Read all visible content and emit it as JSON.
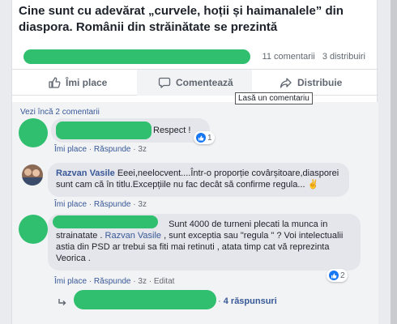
{
  "post": {
    "title": "Cine sunt cu adevărat „curvele, hoții și haimanalele” din diaspora. Românii din străinătate se prezintă"
  },
  "stats": {
    "comments": "11 comentarii",
    "shares": "3 distribuiri"
  },
  "actions": {
    "like": "Îmi place",
    "comment": "Comentează",
    "share": "Distribuie",
    "tooltip": "Lasă un comentariu"
  },
  "comments_section": {
    "previous": "Vezi încă 2 comentarii",
    "comments": [
      {
        "text": "Respect !",
        "like": "Îmi place",
        "reply": "Răspunde",
        "time": "3z",
        "reactions": "1"
      },
      {
        "author": "Razvan Vasile",
        "text": "Eeei,neelocvent....Într-o proporție covârșitoare,diasporei sunt cam că în titlu.Excepțiile nu fac decât să confirme regula...",
        "like": "Îmi place",
        "reply": "Răspunde",
        "time": "3z"
      },
      {
        "text_part1": "Sunt 4000 de turneni plecati la munca in strainatate .",
        "mention": "Razvan Vasile",
        "text_part2": ", sunt exceptia sau \"regula \" ? Voi intelectualii astia din PSD ar trebui sa fiti mai retinuti , atata timp cat vă reprezinta Veorica .",
        "like": "Îmi place",
        "reply": "Răspunde",
        "time": "3z",
        "edited": "Editat",
        "reactions": "2",
        "replies": "4 răspunsuri"
      }
    ]
  },
  "colors": {
    "link": "#385898",
    "redaction": "#2fbf6f",
    "like_blue": "#1877f2"
  }
}
